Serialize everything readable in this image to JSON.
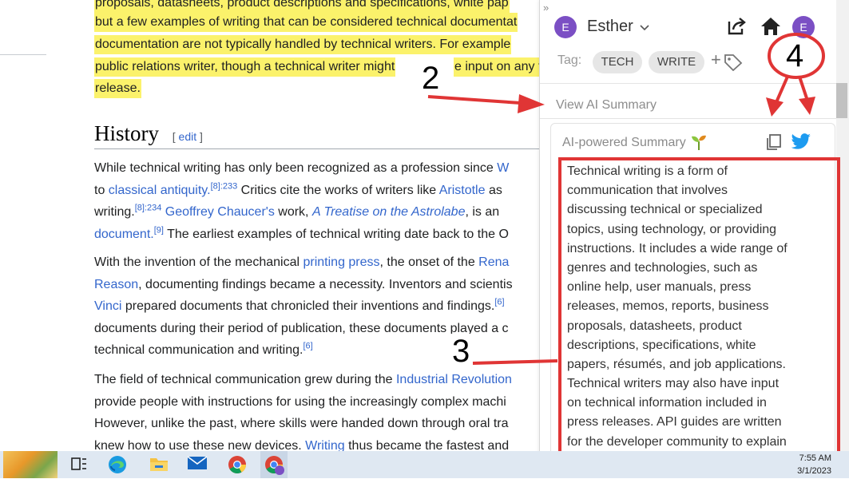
{
  "article": {
    "highlight_lines": [
      "proposals, datasheets, product descriptions and specifications, white pap",
      "but a few examples of writing that can be considered technical documentat",
      "documentation are not typically handled by technical writers. For example",
      "public relations writer, though a technical writer might",
      "e input on any te",
      "release."
    ],
    "history_heading": "History",
    "edit_bracket_open": "[",
    "edit_label": "edit",
    "edit_bracket_close": "]",
    "p1": {
      "l1_a": "While technical writing has only been recognized as a profession since ",
      "l1_link": "W",
      "l2_a": "to ",
      "l2_link": "classical antiquity.",
      "l2_sup": "[8]:233",
      "l2_b": " Critics cite the works of writers like ",
      "l2_link2": "Aristotle",
      "l2_c": " as",
      "l3_a": "writing.",
      "l3_sup": "[8]:234",
      "l3_b": " ",
      "l3_link": "Geoffrey Chaucer's",
      "l3_c": " work, ",
      "l3_link2": "A Treatise on the Astrolabe",
      "l3_d": ", is an",
      "l4_link": "document.",
      "l4_sup": "[9]",
      "l4_b": " The earliest examples of technical writing date back to the O"
    },
    "p2": {
      "l1_a": "With the invention of the mechanical ",
      "l1_link": "printing press",
      "l1_b": ", the onset of the ",
      "l1_link2": "Rena",
      "l2_link": "Reason",
      "l2_b": ", documenting findings became a necessity. Inventors and scientis",
      "l3_link": "Vinci",
      "l3_b": " prepared documents that chronicled their inventions and findings.",
      "l3_sup": "[6]",
      "l4_a": "documents during their period of publication, these documents played a c",
      "l5_a": "technical communication and writing.",
      "l5_sup": "[6]"
    },
    "p3": {
      "l1_a": "The field of technical communication grew during the ",
      "l1_link": "Industrial Revolution",
      "l2_a": "provide people with instructions for using the increasingly complex machi",
      "l3_a": "However, unlike the past, where skills were handed down through oral tra",
      "l4_a": "knew how to use these new devices. ",
      "l4_link": "Writing",
      "l4_b": " thus became the fastest and"
    }
  },
  "annotations": [
    "2",
    "3",
    "4"
  ],
  "panel": {
    "collapse_glyph": "»",
    "user_initial": "E",
    "user_name": "Esther",
    "tag_label": "Tag:",
    "tags": [
      "TECH",
      "WRITE"
    ],
    "add_tag_glyph": "+",
    "view_ai_summary": "View AI Summary",
    "summary_title": "AI-powered Summary",
    "summary_lines": [
      "Technical writing is a form of",
      "communication that involves",
      "discussing technical or specialized",
      "topics, using technology, or providing",
      "instructions. It includes a wide range of",
      "genres and technologies, such as",
      "online help, user manuals, press",
      "releases, memos, reports, business",
      "proposals, datasheets, product",
      "descriptions, specifications, white",
      "papers, résumés, and job applications.",
      "Technical writers may also have input",
      "on technical information included in",
      "press releases. API guides are written",
      "for the developer community to explain"
    ]
  },
  "taskbar": {
    "time": "7:55 AM",
    "date": "3/1/2023"
  },
  "colors": {
    "highlight": "#fbf26b",
    "link": "#3366cc",
    "annotation_red": "#e03535",
    "avatar": "#7b4fc4",
    "twitter": "#1d9bf0"
  }
}
